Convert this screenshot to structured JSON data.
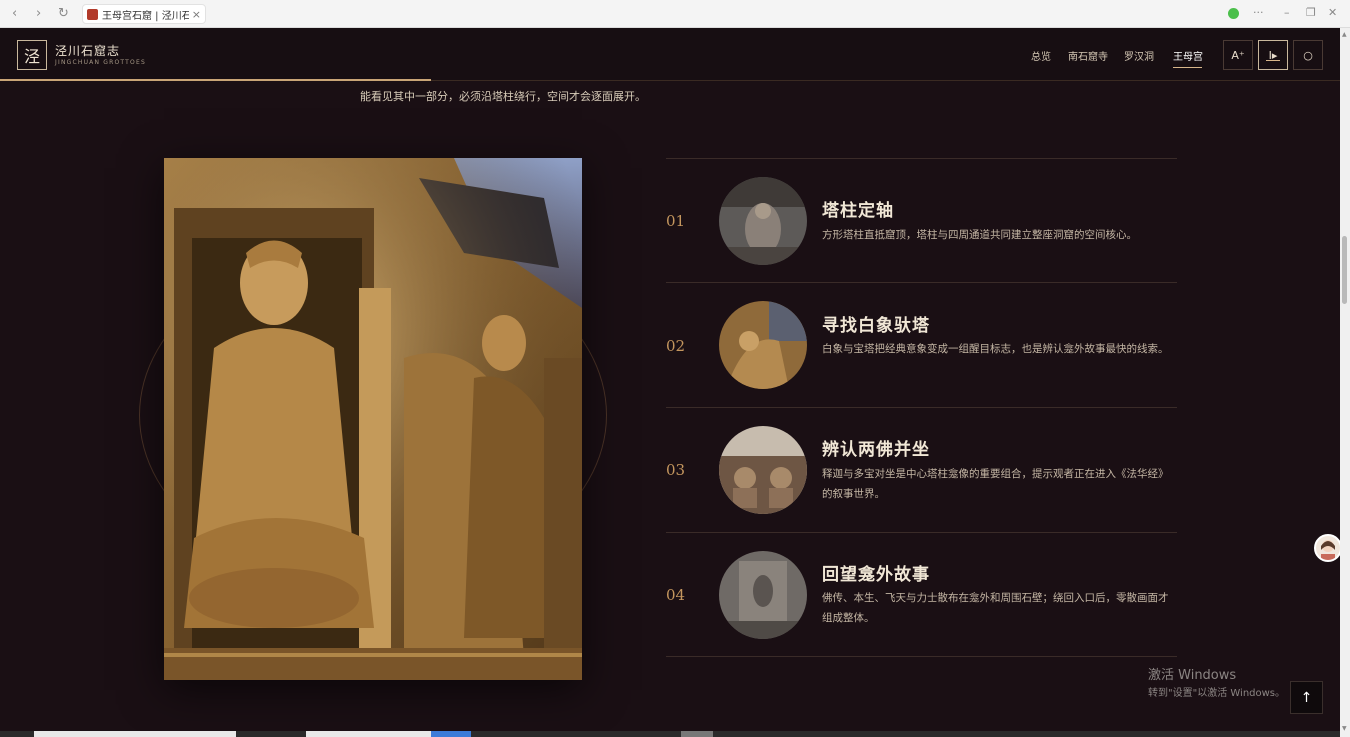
{
  "browser": {
    "tab_title": "王母宫石窟 | 泾川石...",
    "tab_close": "×",
    "back": "‹",
    "forward": "›",
    "reload": "↻",
    "more": "···",
    "minimize": "–",
    "restore": "❐",
    "close": "✕"
  },
  "header": {
    "logo_mark": "泾",
    "logo_cn": "泾川石窟志",
    "logo_en": "JINGCHUAN GROTTOES",
    "menu": [
      "总览",
      "南石窟寺",
      "罗汉洞",
      "王母宫"
    ],
    "active_menu_index": 3,
    "font_button": "A⁺",
    "audio_button": "I▸",
    "theme_button": "○"
  },
  "intro_text": "能看见其中一部分，必须沿塔柱绕行，空间才会逐面展开。",
  "steps": [
    {
      "num": "01",
      "title": "塔柱定轴",
      "desc": "方形塔柱直抵窟顶，塔柱与四周通道共同建立整座洞窟的空间核心。"
    },
    {
      "num": "02",
      "title": "寻找白象驮塔",
      "desc": "白象与宝塔把经典意象变成一组醒目标志，也是辨认龛外故事最快的线索。"
    },
    {
      "num": "03",
      "title": "辨认两佛并坐",
      "desc": "释迦与多宝对坐是中心塔柱龛像的重要组合，提示观者正在进入《法华经》的叙事世界。"
    },
    {
      "num": "04",
      "title": "回望龛外故事",
      "desc": "佛传、本生、飞天与力士散布在龛外和周围石壁；绕回入口后，零散画面才组成整体。"
    }
  ],
  "watermark": {
    "line1": "激活 Windows",
    "line2": "转到\"设置\"以激活 Windows。"
  },
  "back_to_top": "↑",
  "colors": {
    "background": "#1a0f14",
    "accent": "#c4965e",
    "title": "#f1e7d6"
  }
}
